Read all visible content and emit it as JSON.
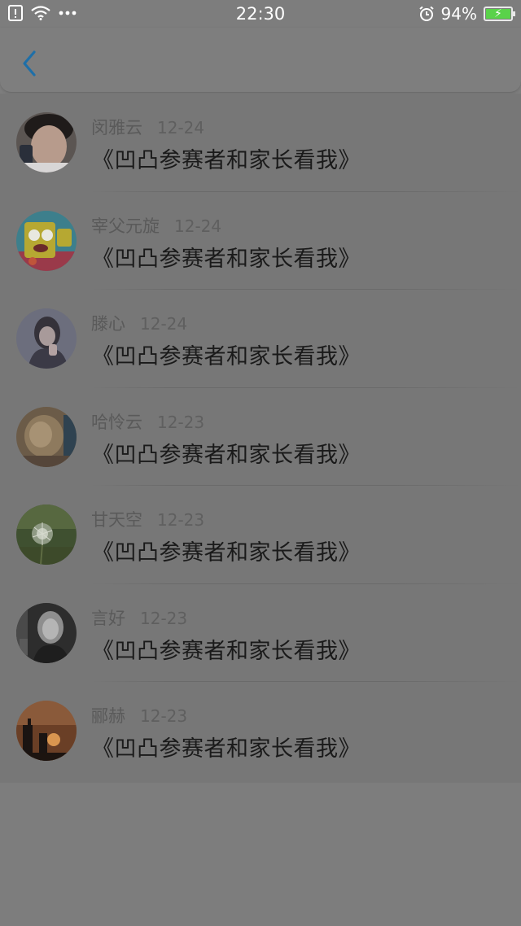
{
  "status_bar": {
    "time": "22:30",
    "battery_percent": "94%",
    "battery_level": 0.94,
    "left_icons": [
      "sim-alert-icon",
      "wifi-icon",
      "more-dots-icon"
    ],
    "right_icons": [
      "alarm-icon",
      "battery-charging-icon"
    ]
  },
  "nav": {
    "back_icon": "chevron-left-icon",
    "back_color": "#1e6fa8"
  },
  "comments": [
    {
      "name": "闵雅云",
      "date": "12-24",
      "text": "《凹凸参赛者和家长看我》",
      "avatar": "avatar-photo-boy"
    },
    {
      "name": "宰父元旋",
      "date": "12-24",
      "text": "《凹凸参赛者和家长看我》",
      "avatar": "avatar-cartoon"
    },
    {
      "name": "滕心",
      "date": "12-24",
      "text": "《凹凸参赛者和家长看我》",
      "avatar": "avatar-photo-girl"
    },
    {
      "name": "哈怜云",
      "date": "12-23",
      "text": "《凹凸参赛者和家长看我》",
      "avatar": "avatar-photo-room"
    },
    {
      "name": "甘天空",
      "date": "12-23",
      "text": "《凹凸参赛者和家长看我》",
      "avatar": "avatar-dandelion"
    },
    {
      "name": "言好",
      "date": "12-23",
      "text": "《凹凸参赛者和家长看我》",
      "avatar": "avatar-photo-woman"
    },
    {
      "name": "郦赫",
      "date": "12-23",
      "text": "《凹凸参赛者和家长看我》",
      "avatar": "avatar-sunset"
    }
  ]
}
